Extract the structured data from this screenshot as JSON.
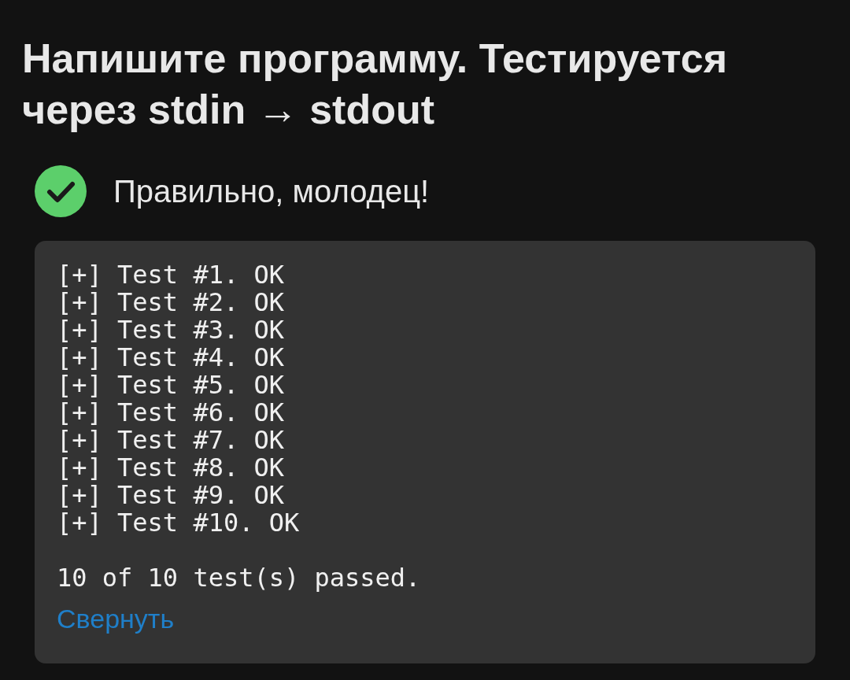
{
  "title": "Напишите программу. Тестируется через stdin → stdout",
  "result": {
    "passed": true,
    "message": "Правильно, молодец!"
  },
  "output": {
    "lines": [
      "[+] Test #1. OK",
      "[+] Test #2. OK",
      "[+] Test #3. OK",
      "[+] Test #4. OK",
      "[+] Test #5. OK",
      "[+] Test #6. OK",
      "[+] Test #7. OK",
      "[+] Test #8. OK",
      "[+] Test #9. OK",
      "[+] Test #10. OK"
    ],
    "summary": "10 of 10 test(s) passed.",
    "collapse_link": "Свернуть"
  }
}
